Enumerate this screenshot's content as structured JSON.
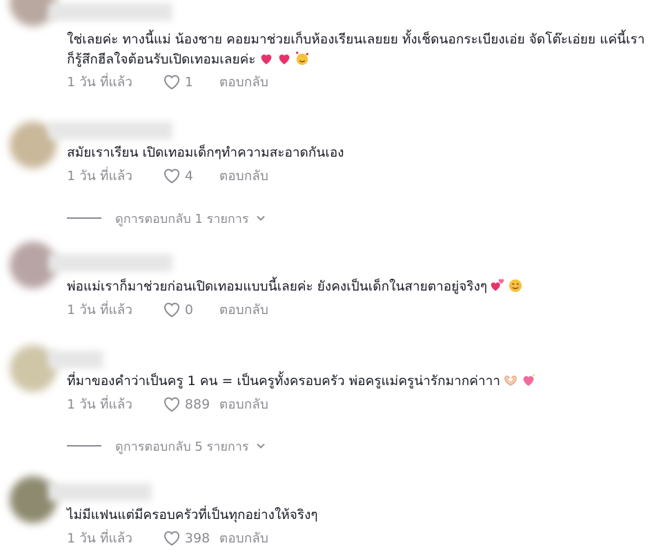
{
  "comments": [
    {
      "text": "ใช่เลยค่ะ ทางนี้แม่ น้องชาย คอยมาช่วยเก็บห้องเรียนเลยยย ทั้งเช็ดนอกระเบียงเอ่ย จัดโต๊ะเอ่ยย แค่นี้เราก็รู้สึกฮีลใจต้อนรับเปิดเทอมเลยค่ะ",
      "emojis": [
        "heart-icon",
        "heart-icon",
        "smiling-face-with-hearts-icon"
      ],
      "time": "1 วัน ที่แล้ว",
      "likes": "1",
      "reply": "ตอบกลับ"
    },
    {
      "text": "สมัยเราเรียน เปิดเทอมเด็กๆทำความสะอาดกันเอง",
      "emojis": [],
      "time": "1 วัน ที่แล้ว",
      "likes": "4",
      "reply": "ตอบกลับ",
      "view_replies": "ดูการตอบกลับ 1 รายการ"
    },
    {
      "text": "พ่อแม่เราก็มาช่วยก่อนเปิดเทอมแบบนี้เลยค่ะ ยังคงเป็นเด็กในสายตาอยู่จริงๆ",
      "emojis": [
        "two-hearts-icon",
        "smiling-face-icon"
      ],
      "time": "1 วัน ที่แล้ว",
      "likes": "0",
      "reply": "ตอบกลับ"
    },
    {
      "text": "ที่มาของคำว่าเป็นครู 1 คน = เป็นครูทั้งครอบครัว พ่อครูแม่ครูน่ารักมากค่าาา",
      "emojis": [
        "heart-hands-icon",
        "sparkling-heart-icon"
      ],
      "time": "1 วัน ที่แล้ว",
      "likes": "889",
      "reply": "ตอบกลับ",
      "view_replies": "ดูการตอบกลับ 5 รายการ"
    },
    {
      "text": "ไม่มีแฟนแต่มีครอบครัวที่เป็นทุกอย่างให้จริงๆ",
      "emojis": [],
      "time": "1 วัน ที่แล้ว",
      "likes": "398",
      "reply": "ตอบกลับ"
    }
  ],
  "colors": {
    "text": "#161823",
    "meta": "#8a8b91",
    "heart_emoji": "#e8326b"
  }
}
